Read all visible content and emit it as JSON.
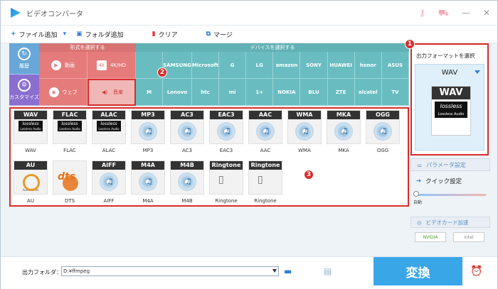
{
  "window": {
    "title": "ビデオコンバータ",
    "icons": [
      "key-icon",
      "cart-icon",
      "minimize-icon",
      "close-icon"
    ]
  },
  "toolbar": {
    "add_file": "ファイル追加",
    "add_folder": "フォルダ追加",
    "clear": "クリア",
    "merge": "マージ"
  },
  "left_tabs": {
    "history": "履歴",
    "custom": "カスタマイズ"
  },
  "format_panel": {
    "header": "形式を選択する",
    "items": [
      "動画",
      "4K/HD",
      "ウェブ",
      "音楽"
    ]
  },
  "device_panel": {
    "header": "デバイスを選択する",
    "row1": [
      "",
      "SAMSUNG",
      "Microsoft",
      "G",
      "LG",
      "amazon",
      "SONY",
      "HUAWEI",
      "honor",
      "ASUS"
    ],
    "row2": [
      "M",
      "Lenovo",
      "htc",
      "mi",
      "1+",
      "NOKIA",
      "BLU",
      "ZTE",
      "alcatel",
      "TV"
    ]
  },
  "output": {
    "label": "出力フォーマットを選択",
    "selected": "WAV",
    "lossless": "lossless",
    "lossless_audio": "Lossless Audio"
  },
  "tiles_row1": [
    {
      "label": "WAV",
      "top": "WAV",
      "style": "lossless"
    },
    {
      "label": "FLAC",
      "top": "FLAC",
      "style": "lossless"
    },
    {
      "label": "ALAC",
      "top": "ALAC",
      "style": "lossless"
    },
    {
      "label": "MP3",
      "top": "MP3",
      "style": "disc"
    },
    {
      "label": "AC3",
      "top": "AC3",
      "style": "disc"
    },
    {
      "label": "EAC3",
      "top": "EAC3",
      "style": "disc"
    },
    {
      "label": "AAC",
      "top": "AAC",
      "style": "disc"
    },
    {
      "label": "WMA",
      "top": "WMA",
      "style": "disc"
    },
    {
      "label": "MKA",
      "top": "MKA",
      "style": "disc"
    },
    {
      "label": "OGG",
      "top": "OGG",
      "style": "disc"
    }
  ],
  "tiles_row2": [
    {
      "label": "AU",
      "top": "AU",
      "style": "au"
    },
    {
      "label": "DTS",
      "top": "",
      "style": "dts"
    },
    {
      "label": "AIFF",
      "top": "AIFF",
      "style": "disc"
    },
    {
      "label": "M4A",
      "top": "M4A",
      "style": "disc"
    },
    {
      "label": "M4B",
      "top": "M4B",
      "style": "disc"
    },
    {
      "label": "Ringtone",
      "top": "Ringtone",
      "style": "phone"
    },
    {
      "label": "Ringtone",
      "top": "Ringtone",
      "style": "phone"
    }
  ],
  "tile_text": {
    "lossless": "lossless",
    "lossless_audio": "Lossless Audio",
    "au_caption": "Audio Units",
    "dts": "dts",
    "dts_caption": "Surround"
  },
  "right": {
    "params": "パラメータ設定",
    "quick": "クイック設定",
    "auto": "自動",
    "gpu": "ビデオカード加速",
    "nvidia": "NVIDIA",
    "intel": "Intel"
  },
  "bottom": {
    "folder_label": "出力フォルダ：",
    "path": "D:¥ffmpeg",
    "convert": "変換"
  },
  "badges": [
    "1",
    "2",
    "3"
  ]
}
